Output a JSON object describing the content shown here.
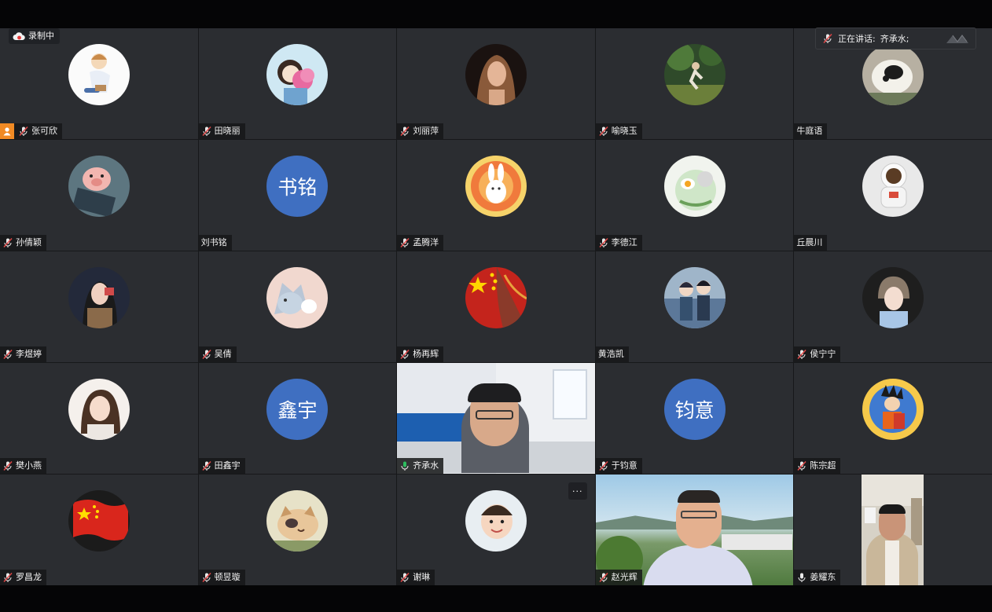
{
  "status": {
    "recording_label": "录制中",
    "speaking_prefix": "正在讲话:",
    "speaking_name": "齐承水;"
  },
  "participants": [
    {
      "name": "张可欣",
      "avatar": "cartoon-girl",
      "mic": "muted",
      "host": true
    },
    {
      "name": "田晓丽",
      "avatar": "girl-flowers",
      "mic": "muted"
    },
    {
      "name": "刘丽萍",
      "avatar": "woman-photo",
      "mic": "muted"
    },
    {
      "name": "喻晓玉",
      "avatar": "forest-runner",
      "mic": "muted"
    },
    {
      "name": "牛庭语",
      "avatar": "cat-photo",
      "mic": "none"
    },
    {
      "name": "孙倩颖",
      "avatar": "pig-toy",
      "mic": "muted"
    },
    {
      "name": "刘书铭",
      "avatar_text": "书铭",
      "mic": "none"
    },
    {
      "name": "孟腾洋",
      "avatar": "rabbit-sun",
      "mic": "muted"
    },
    {
      "name": "李德江",
      "avatar": "anime-egg",
      "mic": "muted"
    },
    {
      "name": "丘晨川",
      "avatar": "astronaut",
      "mic": "none"
    },
    {
      "name": "李煜婷",
      "avatar": "girl-photo",
      "mic": "muted"
    },
    {
      "name": "吴倩",
      "avatar": "fox-cartoon",
      "mic": "muted"
    },
    {
      "name": "杨再辉",
      "avatar": "china-flag-art",
      "mic": "muted"
    },
    {
      "name": "黄浩凯",
      "avatar": "anime-couple",
      "mic": "none"
    },
    {
      "name": "侯宁宁",
      "avatar": "boy-photo",
      "mic": "muted"
    },
    {
      "name": "樊小燕",
      "avatar": "girl-portrait",
      "mic": "muted"
    },
    {
      "name": "田鑫宇",
      "avatar_text": "鑫宇",
      "mic": "muted"
    },
    {
      "name": "齐承水",
      "avatar": "video-classroom",
      "mic": "active",
      "active": true
    },
    {
      "name": "于钧意",
      "avatar_text": "钧意",
      "mic": "muted"
    },
    {
      "name": "陈宗超",
      "avatar": "dragonball",
      "mic": "muted"
    },
    {
      "name": "罗昌龙",
      "avatar": "china-flag",
      "mic": "muted"
    },
    {
      "name": "顿昱璇",
      "avatar": "cat-cartoon",
      "mic": "muted"
    },
    {
      "name": "谢琳",
      "avatar": "baby-photo",
      "mic": "muted",
      "more_label": "···"
    },
    {
      "name": "赵光辉",
      "avatar": "video-outdoor",
      "mic": "muted"
    },
    {
      "name": "姜耀东",
      "avatar": "video-room",
      "mic": "on"
    }
  ]
}
